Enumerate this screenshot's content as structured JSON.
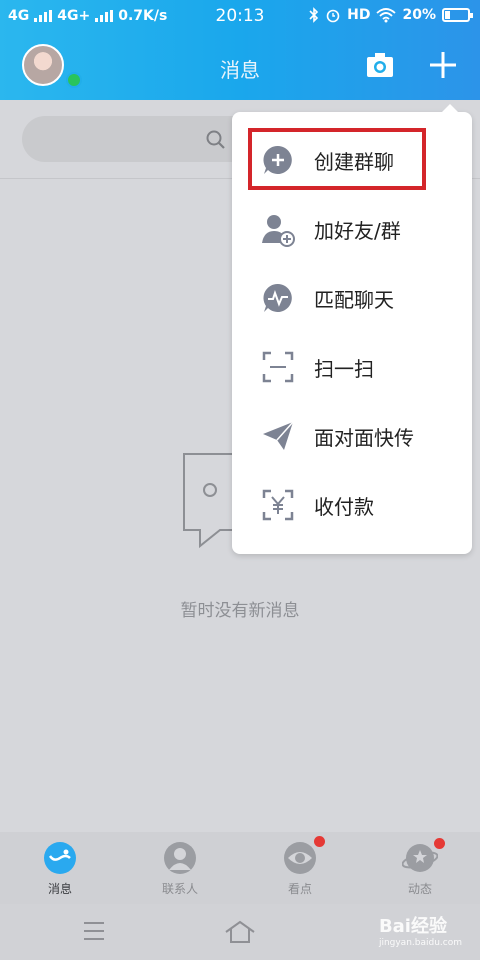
{
  "status_bar": {
    "net1": "4G",
    "net2": "4G+",
    "speed": "0.7K/s",
    "time": "20:13",
    "hd": "HD",
    "battery": "20%"
  },
  "header": {
    "title": "消息",
    "camera_icon": "camera-icon",
    "plus_icon": "plus-icon"
  },
  "search": {
    "icon": "search-icon"
  },
  "menu": {
    "items": [
      {
        "label": "创建群聊",
        "icon": "create-group-icon"
      },
      {
        "label": "加好友/群",
        "icon": "add-friend-icon"
      },
      {
        "label": "匹配聊天",
        "icon": "match-chat-icon"
      },
      {
        "label": "扫一扫",
        "icon": "scan-icon"
      },
      {
        "label": "面对面快传",
        "icon": "send-icon"
      },
      {
        "label": "收付款",
        "icon": "payment-icon"
      }
    ],
    "highlight_color": "#d4252a"
  },
  "empty_state": {
    "text": "暂时没有新消息"
  },
  "tabs": [
    {
      "label": "消息",
      "icon": "message-icon",
      "active": true,
      "badge": false
    },
    {
      "label": "联系人",
      "icon": "contacts-icon",
      "active": false,
      "badge": false
    },
    {
      "label": "看点",
      "icon": "eye-icon",
      "active": false,
      "badge": true
    },
    {
      "label": "动态",
      "icon": "planet-icon",
      "active": false,
      "badge": true
    }
  ],
  "watermark": {
    "main": "Bai经验",
    "sub": "jingyan.baidu.com"
  },
  "colors": {
    "header_blue": "#1aa7ec",
    "accent_badge": "#e53935",
    "online_green": "#29c45c"
  }
}
